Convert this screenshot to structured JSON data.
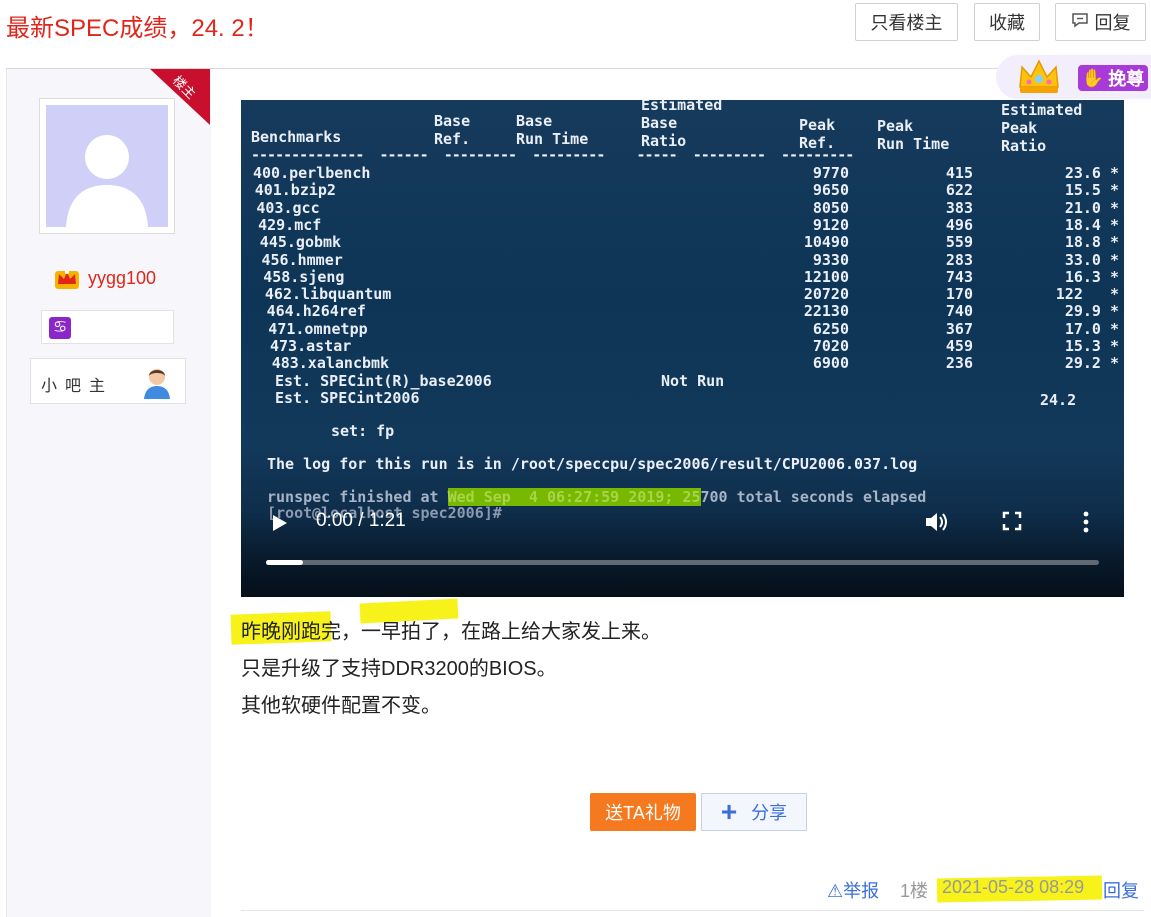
{
  "thread": {
    "title": "最新SPEC成绩，24. 2！"
  },
  "header_buttons": {
    "only_op": "只看楼主",
    "favorite": "收藏",
    "reply": "回复"
  },
  "author": {
    "badge": "楼主",
    "name": "yygg100",
    "zodiac": "♋",
    "role": "小吧主"
  },
  "vip": {
    "tag": "挽尊"
  },
  "video": {
    "screen": {
      "header": {
        "benchmarks": "Benchmarks",
        "base_ref": "Base\nRef.",
        "base_run": "Base\nRun Time",
        "est_base": "Estimated\nBase\nRatio",
        "peak_ref": "Peak\nRef.",
        "peak_run": "Peak\nRun Time",
        "est_peak": "Estimated\nPeak\nRatio"
      },
      "rows": [
        {
          "name": "400.perlbench",
          "ref": "9770",
          "run": "415",
          "ratio": "23.6 *"
        },
        {
          "name": "401.bzip2",
          "ref": "9650",
          "run": "622",
          "ratio": "15.5 *"
        },
        {
          "name": "403.gcc",
          "ref": "8050",
          "run": "383",
          "ratio": "21.0 *"
        },
        {
          "name": "429.mcf",
          "ref": "9120",
          "run": "496",
          "ratio": "18.4 *"
        },
        {
          "name": "445.gobmk",
          "ref": "10490",
          "run": "559",
          "ratio": "18.8 *"
        },
        {
          "name": "456.hmmer",
          "ref": "9330",
          "run": "283",
          "ratio": "33.0 *"
        },
        {
          "name": "458.sjeng",
          "ref": "12100",
          "run": "743",
          "ratio": "16.3 *"
        },
        {
          "name": "462.libquantum",
          "ref": "20720",
          "run": "170",
          "ratio": "122   *"
        },
        {
          "name": "464.h264ref",
          "ref": "22130",
          "run": "740",
          "ratio": "29.9 *"
        },
        {
          "name": "471.omnetpp",
          "ref": "6250",
          "run": "367",
          "ratio": "17.0 *"
        },
        {
          "name": "473.astar",
          "ref": "7020",
          "run": "459",
          "ratio": "15.3 *"
        },
        {
          "name": "483.xalancbmk",
          "ref": "6900",
          "run": "236",
          "ratio": "29.2 *"
        }
      ],
      "est_base_line": "Est. SPECint(R)_base2006",
      "not_run": "Not Run",
      "est_line": "Est. SPECint2006",
      "est_value": "24.2",
      "set_line": "set: fp",
      "log_line": "The log for this run is in /root/speccpu/spec2006/result/CPU2006.037.log",
      "finished_prefix": "runspec finished at ",
      "finished_date": "Wed Sep  4 06:27:59 2019; 25",
      "finished_suffix": "700 total seconds elapsed",
      "prompt_line": "[root@localhost spec2006]#"
    },
    "time": "0:00 / 1:21",
    "progress": 0.045
  },
  "post": {
    "lines": [
      "昨晚刚跑完，一早拍了，在路上给大家发上来。",
      "只是升级了支持DDR3200的BIOS。",
      "其他软硬件配置不变。"
    ]
  },
  "actions": {
    "gift": "送TA礼物",
    "share": "分享"
  },
  "footer": {
    "report": "举报",
    "floor": "1楼",
    "datetime": "2021-05-28 08:29",
    "reply": "回复"
  },
  "colors": {
    "accent_red": "#e1251b",
    "gift_orange": "#f4791f",
    "highlight": "#f7f21a",
    "share_blue": "#3a6fd8"
  }
}
